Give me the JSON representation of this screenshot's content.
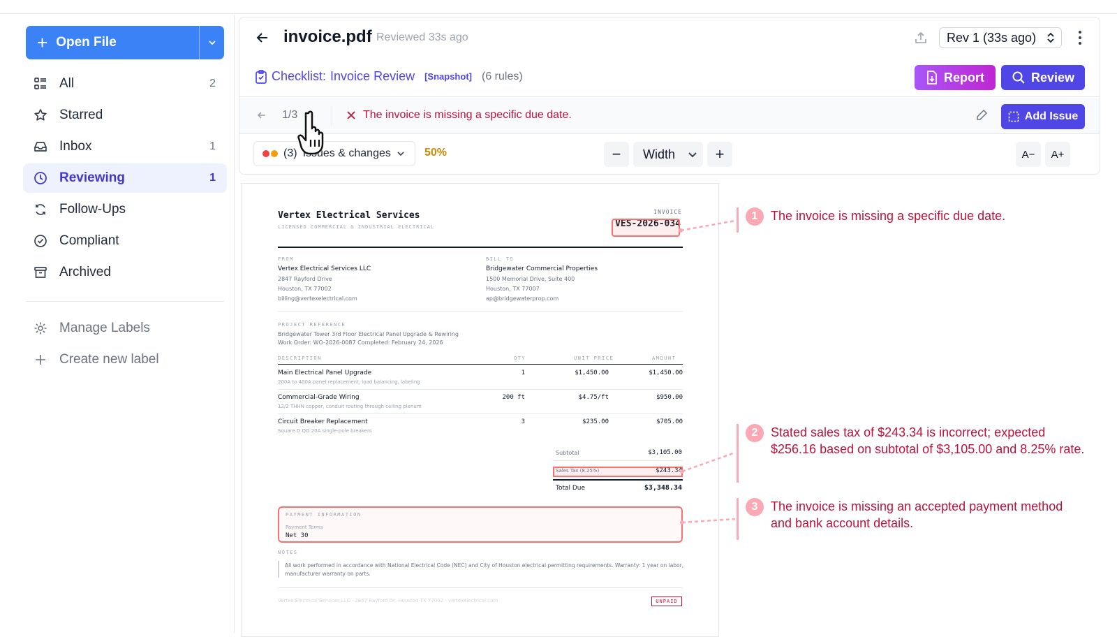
{
  "sidebar": {
    "open_file_label": "Open File",
    "items": [
      {
        "label": "All",
        "count": "2",
        "icon": "list-icon"
      },
      {
        "label": "Starred",
        "count": "",
        "icon": "star-icon"
      },
      {
        "label": "Inbox",
        "count": "1",
        "icon": "inbox-icon"
      },
      {
        "label": "Reviewing",
        "count": "1",
        "icon": "clock-icon"
      },
      {
        "label": "Follow-Ups",
        "count": "",
        "icon": "refresh-icon"
      },
      {
        "label": "Compliant",
        "count": "",
        "icon": "check-circle-icon"
      },
      {
        "label": "Archived",
        "count": "",
        "icon": "archive-icon"
      }
    ],
    "manage_labels": "Manage Labels",
    "create_label": "Create new label"
  },
  "header": {
    "title": "invoice.pdf",
    "reviewed": "Reviewed 33s ago",
    "revision": "Rev 1 (33s ago)"
  },
  "checklist": {
    "prefix": "Checklist:",
    "name": "Invoice Review",
    "snapshot": "[Snapshot]",
    "rules": "(6 rules)",
    "report_label": "Report",
    "review_label": "Review"
  },
  "issue_nav": {
    "pager": "1/3",
    "current_issue": "The invoice is missing a specific due date.",
    "add_issue_label": "Add Issue"
  },
  "toolbar": {
    "issues_count": "(3)",
    "issues_label": "Issues & changes",
    "percent": "50%",
    "zoom_minus": "−",
    "zoom_mode": "Width",
    "zoom_plus": "+",
    "font_dec": "A−",
    "font_inc": "A+"
  },
  "invoice": {
    "company": "Vertex Electrical Services",
    "company_sub": "LICENSED COMMERCIAL & INDUSTRIAL ELECTRICAL",
    "invoice_label": "INVOICE",
    "invoice_number": "VES-2026-034",
    "from_label": "FROM",
    "from_name": "Vertex Electrical Services LLC",
    "from_addr1": "2847 Rayford Drive",
    "from_addr2": "Houston, TX 77002",
    "from_email": "billing@vertexelectrical.com",
    "bill_label": "BILL TO",
    "bill_name": "Bridgewater Commercial Properties",
    "bill_addr1": "1500 Memorial Drive, Suite 400",
    "bill_addr2": "Houston, TX 77007",
    "bill_email": "ap@bridgewaterprop.com",
    "project_label": "PROJECT REFERENCE",
    "project_line1": "Bridgewater Tower    3rd Floor Electrical Panel Upgrade & Rewiring",
    "project_line2": "Work Order: WO-2026-0087    Completed: February 24, 2026",
    "col_desc": "DESCRIPTION",
    "col_qty": "QTY",
    "col_unit": "UNIT PRICE",
    "col_amount": "AMOUNT",
    "lines": [
      {
        "desc": "Main Electrical Panel Upgrade",
        "sub": "200A to 400A panel replacement, load balancing, labeling",
        "qty": "1",
        "unit": "$1,450.00",
        "amount": "$1,450.00"
      },
      {
        "desc": "Commercial-Grade Wiring",
        "sub": "12/2 THHN copper, conduit routing through ceiling plenum",
        "qty": "200 ft",
        "unit": "$4.75/ft",
        "amount": "$950.00"
      },
      {
        "desc": "Circuit Breaker Replacement",
        "sub": "Square D QO 20A single-pole breakers",
        "qty": "3",
        "unit": "$235.00",
        "amount": "$705.00"
      }
    ],
    "subtotal_label": "Subtotal",
    "subtotal": "$3,105.00",
    "tax_label": "Sales Tax (8.25%)",
    "tax": "$243.34",
    "total_label": "Total Due",
    "total": "$3,348.34",
    "payment_label": "PAYMENT INFORMATION",
    "terms_label": "Payment Terms",
    "terms": "Net 30",
    "notes_label": "NOTES",
    "notes_line1": "All work performed in accordance with National Electrical Code (NEC) and City of Houston electrical permitting requirements. Warranty: 1 year on labor,",
    "notes_line2": "manufacturer warranty on parts.",
    "footer": "Vertex Electrical Services LLC · 2847 Rayford Dr, Houston TX 77002 · vertexelectrical.com",
    "status": "UNPAID"
  },
  "annotations": [
    {
      "num": "1",
      "text": "The invoice is missing a specific due date."
    },
    {
      "num": "2",
      "text": "Stated sales tax of $243.34 is incorrect; expected $256.16 based on subtotal of $3,105.00 and 8.25% rate."
    },
    {
      "num": "3",
      "text": "The invoice is missing an accepted payment method and bank account details."
    }
  ],
  "colors": {
    "primary": "#4f46e5",
    "open_file": "#3b82f6",
    "error": "#be123c",
    "highlight": "#f87171",
    "warning": "#ca8a04"
  }
}
